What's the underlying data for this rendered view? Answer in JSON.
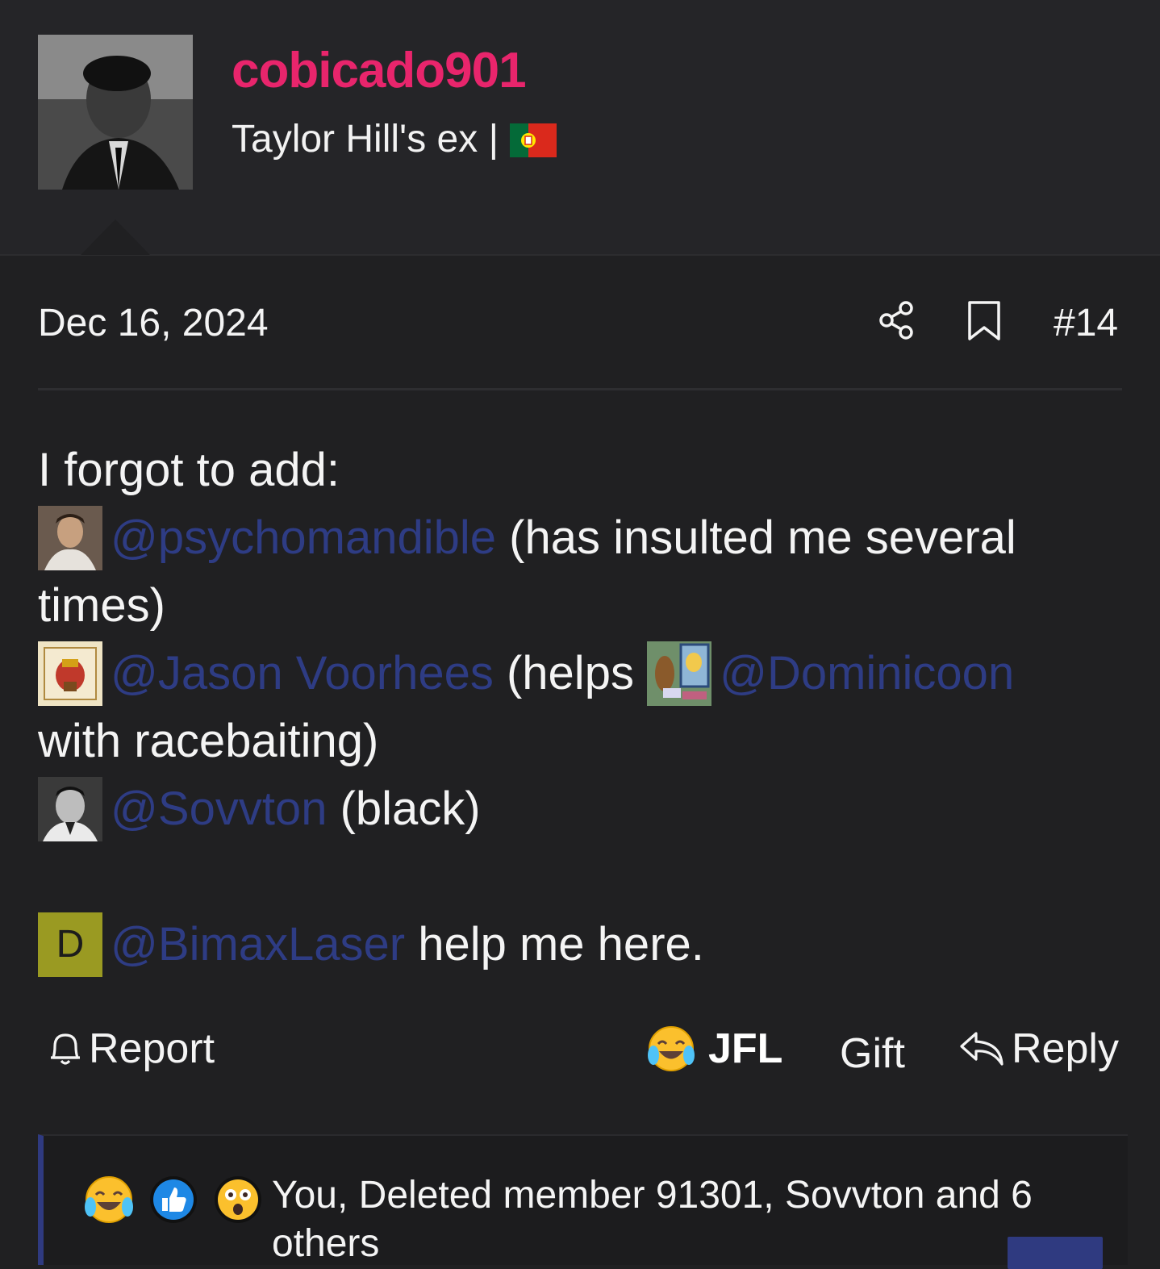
{
  "user": {
    "username": "cobicado901",
    "title": "Taylor Hill's ex |",
    "flag_icon": "portugal-flag-icon"
  },
  "post": {
    "date": "Dec 16, 2024",
    "number": "#14",
    "lines": {
      "intro": "I forgot to add:",
      "m1_name": "@psychomandible",
      "m1_text": " (has insulted me several",
      "m1_text2": "times)",
      "m2_name": "@Jason Voorhees",
      "m2_text": " (helps ",
      "m3_name": "@Dominicoon",
      "m3_text2": "with racebaiting)",
      "m4_name": "@Sovvton",
      "m4_text": " (black)",
      "m5_avatar_letter": "D",
      "m5_name": "@BimaxLaser",
      "m5_text": " help me here."
    }
  },
  "actions": {
    "report": "Report",
    "jfl": "JFL",
    "gift": "Gift",
    "reply": "Reply"
  },
  "reactions": {
    "icons": [
      "joy-emoji-icon",
      "like-thumb-icon",
      "astonished-emoji-icon"
    ],
    "summary": "You, Deleted member 91301, Sovvton and 6 others"
  },
  "colors": {
    "username": "#e8256c",
    "mention": "#2e3c84",
    "background": "#202022",
    "accent": "#2f3a80"
  }
}
